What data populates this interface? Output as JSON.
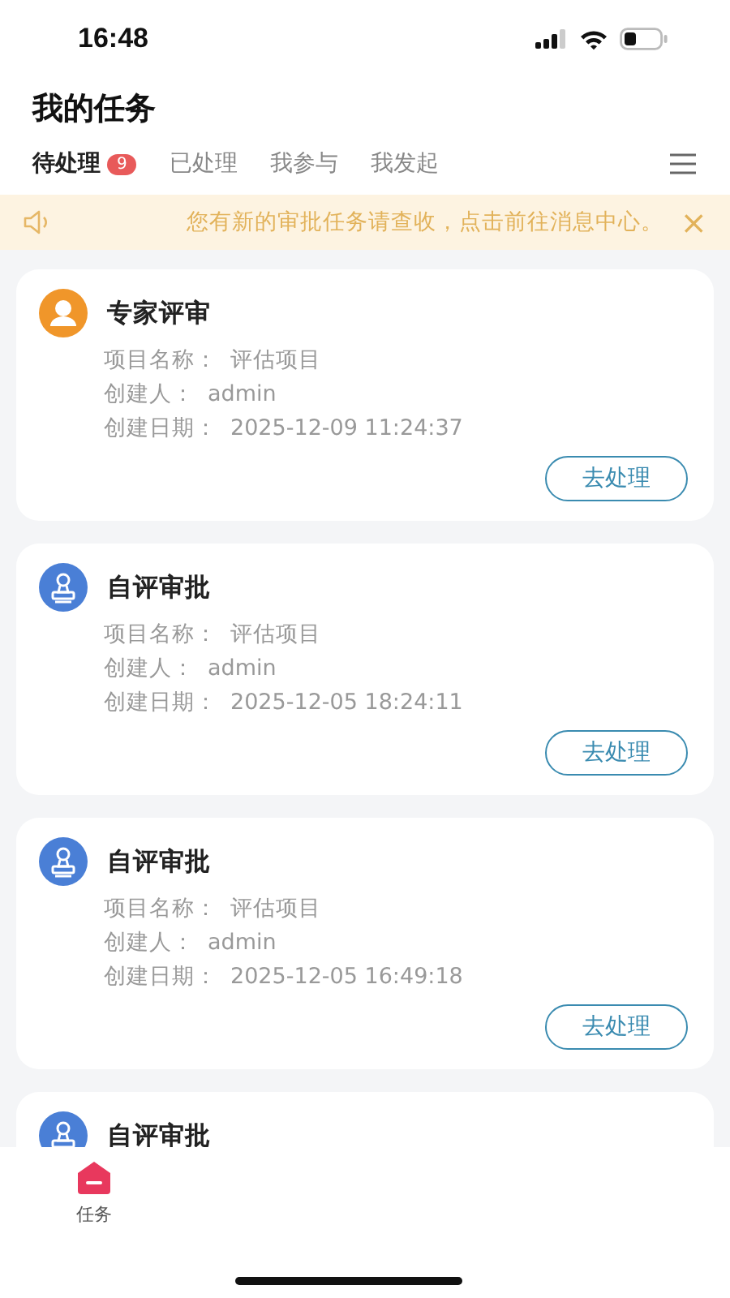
{
  "status_bar": {
    "time": "16:48"
  },
  "title": "我的任务",
  "tabs": [
    {
      "label": "待处理",
      "badge": "9",
      "selected": true
    },
    {
      "label": "已处理",
      "selected": false
    },
    {
      "label": "我参与",
      "selected": false
    },
    {
      "label": "我发起",
      "selected": false
    }
  ],
  "notice": {
    "text": "您有新的审批任务请查收，点击前往消息中心。",
    "close": "×"
  },
  "tasks": [
    {
      "kind": "expert",
      "title": "专家评审",
      "fields": [
        {
          "label": "项目名称：",
          "value": "评估项目"
        },
        {
          "label": "创建人：",
          "value": "admin"
        },
        {
          "label": "创建日期：",
          "value": "2025-12-09 11:24:37"
        }
      ],
      "action": "去处理"
    },
    {
      "kind": "self",
      "title": "自评审批",
      "fields": [
        {
          "label": "项目名称：",
          "value": "评估项目"
        },
        {
          "label": "创建人：",
          "value": "admin"
        },
        {
          "label": "创建日期：",
          "value": "2025-12-05 18:24:11"
        }
      ],
      "action": "去处理"
    },
    {
      "kind": "self",
      "title": "自评审批",
      "fields": [
        {
          "label": "项目名称：",
          "value": "评估项目"
        },
        {
          "label": "创建人：",
          "value": "admin"
        },
        {
          "label": "创建日期：",
          "value": "2025-12-05 16:49:18"
        }
      ],
      "action": "去处理"
    },
    {
      "kind": "self",
      "title": "自评审批"
    }
  ],
  "bottom_nav": [
    {
      "label": "任务",
      "selected": true
    }
  ]
}
